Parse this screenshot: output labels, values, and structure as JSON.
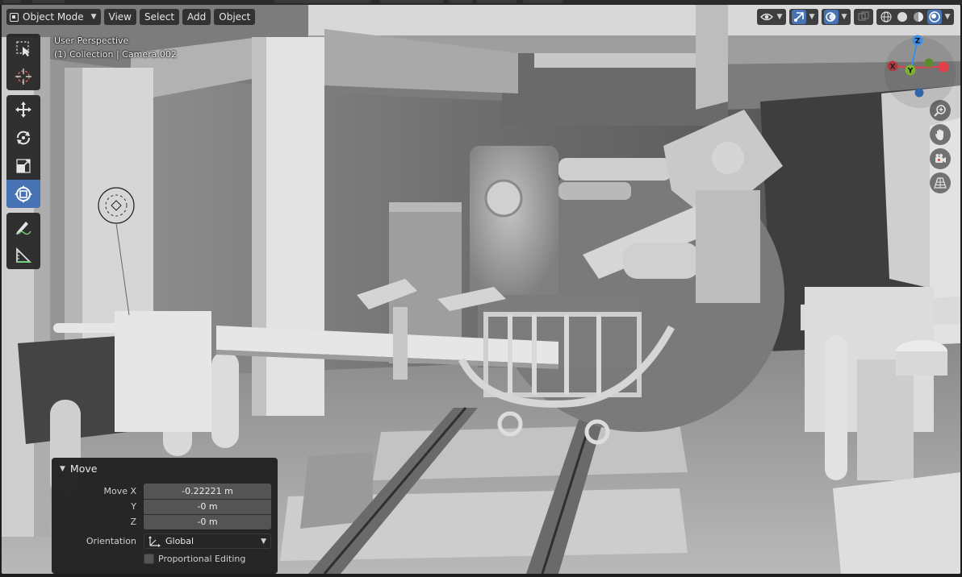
{
  "header": {
    "mode_label": "Object Mode",
    "menus": [
      "View",
      "Select",
      "Add",
      "Object"
    ]
  },
  "viewport_info": {
    "perspective": "User Perspective",
    "collection": "(1) Collection | Camera.002"
  },
  "toolbar": {
    "tools": [
      "select-box-icon",
      "cursor-icon",
      "move-icon",
      "rotate-icon",
      "scale-icon",
      "transform-icon",
      "annotate-icon",
      "measure-icon"
    ],
    "active_tool": "transform-icon"
  },
  "gizmo": {
    "axis_labels": {
      "x": "X",
      "y": "Y",
      "z": "Z"
    },
    "colors": {
      "x": "#e0404a",
      "y": "#7ab430",
      "z": "#3c8ee8"
    }
  },
  "nav_buttons": [
    "zoom-icon",
    "pan-hand-icon",
    "camera-view-icon",
    "ortho-grid-icon"
  ],
  "operator_panel": {
    "title": "Move",
    "move_x_label": "Move X",
    "move_x_value": "-0.22221 m",
    "y_label": "Y",
    "y_value": "-0 m",
    "z_label": "Z",
    "z_value": "-0 m",
    "orientation_label": "Orientation",
    "orientation_value": "Global",
    "proportional_label": "Proportional Editing",
    "proportional_checked": false
  },
  "colors": {
    "accent": "#4772b3",
    "panel_bg": "#202020",
    "field_bg": "#545454"
  }
}
